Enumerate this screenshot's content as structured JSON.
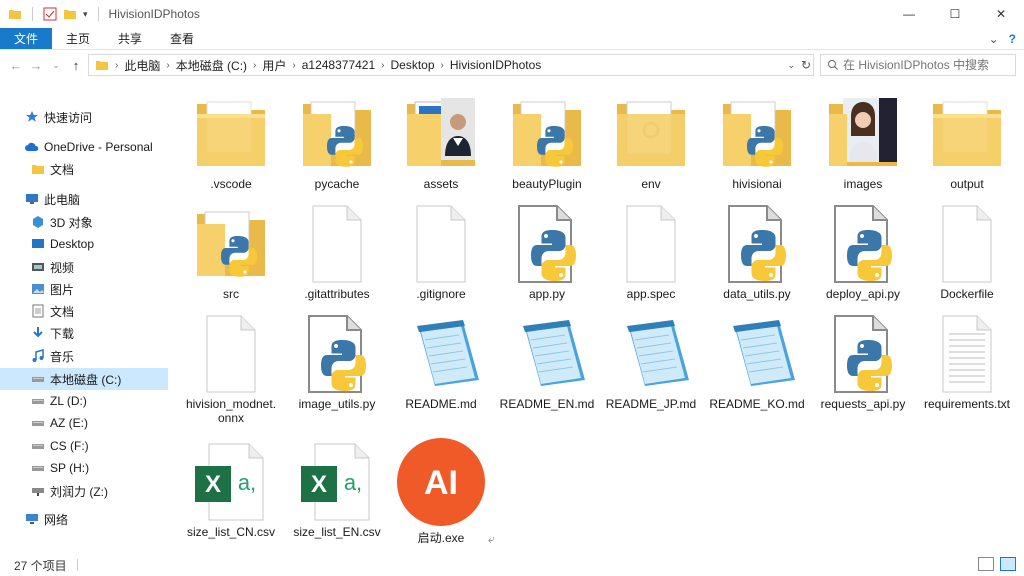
{
  "window": {
    "title": "HivisionIDPhotos",
    "controls": {
      "minimize": "—",
      "maximize": "☐",
      "close": "✕"
    }
  },
  "ribbon": {
    "tabs": [
      {
        "label": "文件"
      },
      {
        "label": "主页"
      },
      {
        "label": "共享"
      },
      {
        "label": "查看"
      }
    ],
    "expand_icon": "⌄",
    "help_icon": "?"
  },
  "address": {
    "crumbs": [
      "此电脑",
      "本地磁盘 (C:)",
      "用户",
      "a1248377421",
      "Desktop",
      "HivisionIDPhotos"
    ],
    "search_placeholder": "在 HivisionIDPhotos 中搜索"
  },
  "nav": {
    "items": [
      {
        "label": "快速访问",
        "icon": "star-icon",
        "level": 0,
        "selected": false
      },
      {
        "label": "OneDrive - Personal",
        "icon": "cloud-icon",
        "level": 0,
        "selected": false
      },
      {
        "label": "文档",
        "icon": "folder-icon",
        "level": 1,
        "selected": false
      },
      {
        "label": "此电脑",
        "icon": "computer-icon",
        "level": 0,
        "selected": false
      },
      {
        "label": "3D 对象",
        "icon": "cube-icon",
        "level": 1,
        "selected": false
      },
      {
        "label": "Desktop",
        "icon": "desktop-icon",
        "level": 1,
        "selected": false
      },
      {
        "label": "视频",
        "icon": "video-icon",
        "level": 1,
        "selected": false
      },
      {
        "label": "图片",
        "icon": "picture-icon",
        "level": 1,
        "selected": false
      },
      {
        "label": "文档",
        "icon": "document-icon",
        "level": 1,
        "selected": false
      },
      {
        "label": "下载",
        "icon": "download-icon",
        "level": 1,
        "selected": false
      },
      {
        "label": "音乐",
        "icon": "music-icon",
        "level": 1,
        "selected": false
      },
      {
        "label": "本地磁盘 (C:)",
        "icon": "drive-icon",
        "level": 1,
        "selected": true
      },
      {
        "label": "ZL (D:)",
        "icon": "drive-icon",
        "level": 1,
        "selected": false
      },
      {
        "label": "AZ (E:)",
        "icon": "drive-icon",
        "level": 1,
        "selected": false
      },
      {
        "label": "CS (F:)",
        "icon": "drive-icon",
        "level": 1,
        "selected": false
      },
      {
        "label": "SP (H:)",
        "icon": "drive-icon",
        "level": 1,
        "selected": false
      },
      {
        "label": "刘润力 (Z:)",
        "icon": "network-drive-icon",
        "level": 1,
        "selected": false
      },
      {
        "label": "网络",
        "icon": "network-icon",
        "level": 0,
        "selected": false
      }
    ]
  },
  "files": [
    {
      "name": ".vscode",
      "type": "folder"
    },
    {
      "name": "pycache",
      "type": "folder-py"
    },
    {
      "name": "assets",
      "type": "folder-photo"
    },
    {
      "name": "beautyPlugin",
      "type": "folder-py"
    },
    {
      "name": "env",
      "type": "folder-gear"
    },
    {
      "name": "hivisionai",
      "type": "folder-py"
    },
    {
      "name": "images",
      "type": "folder-photo2"
    },
    {
      "name": "output",
      "type": "folder"
    },
    {
      "name": "src",
      "type": "folder-py"
    },
    {
      "name": ".gitattributes",
      "type": "blank"
    },
    {
      "name": ".gitignore",
      "type": "blank"
    },
    {
      "name": "app.py",
      "type": "python"
    },
    {
      "name": "app.spec",
      "type": "blank"
    },
    {
      "name": "data_utils.py",
      "type": "python"
    },
    {
      "name": "deploy_api.py",
      "type": "python"
    },
    {
      "name": "Dockerfile",
      "type": "blank"
    },
    {
      "name": "hivision_modnet.onnx",
      "type": "blank"
    },
    {
      "name": "image_utils.py",
      "type": "python"
    },
    {
      "name": "README.md",
      "type": "notepad"
    },
    {
      "name": "README_EN.md",
      "type": "notepad"
    },
    {
      "name": "README_JP.md",
      "type": "notepad"
    },
    {
      "name": "README_KO.md",
      "type": "notepad"
    },
    {
      "name": "requests_api.py",
      "type": "python"
    },
    {
      "name": "requirements.txt",
      "type": "text"
    },
    {
      "name": "size_list_CN.csv",
      "type": "csv"
    },
    {
      "name": "size_list_EN.csv",
      "type": "csv"
    },
    {
      "name": "启动.exe",
      "type": "exe-ai"
    }
  ],
  "icons": {
    "csv_x": "X",
    "csv_a": "a,",
    "exe_ai": "AI"
  },
  "status": {
    "count": "27 个项目"
  },
  "colors": {
    "accent": "#1979ca",
    "folder": "#f5d06b",
    "excel": "#1e7145",
    "ai_orange": "#f05a28"
  }
}
